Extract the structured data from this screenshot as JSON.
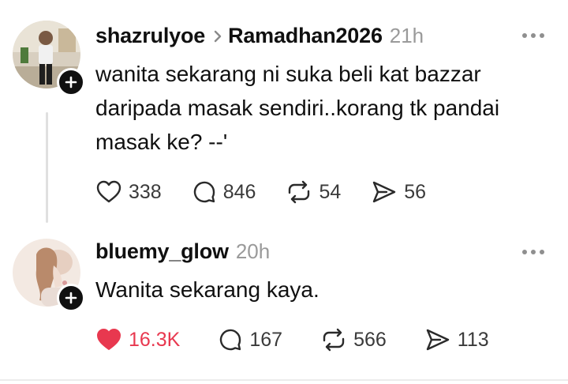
{
  "posts": [
    {
      "username": "shazrulyoe",
      "topic": "Ramadhan2026",
      "time": "21h",
      "text": "wanita sekarang ni suka beli kat bazzar\ndaripada masak sendiri..korang tk pandai\nmasak ke? --'",
      "likes": "338",
      "comments": "846",
      "reposts": "54",
      "shares": "56",
      "liked": false
    },
    {
      "username": "bluemy_glow",
      "time": "20h",
      "text": "Wanita sekarang kaya.",
      "likes": "16.3K",
      "comments": "167",
      "reposts": "566",
      "shares": "113",
      "liked": true
    }
  ],
  "colors": {
    "like_active": "#e8384f",
    "text": "#101010",
    "muted": "#9a9a9a"
  },
  "icons": [
    "plus-icon",
    "more-icon",
    "heart-icon",
    "comment-icon",
    "repost-icon",
    "share-icon"
  ]
}
